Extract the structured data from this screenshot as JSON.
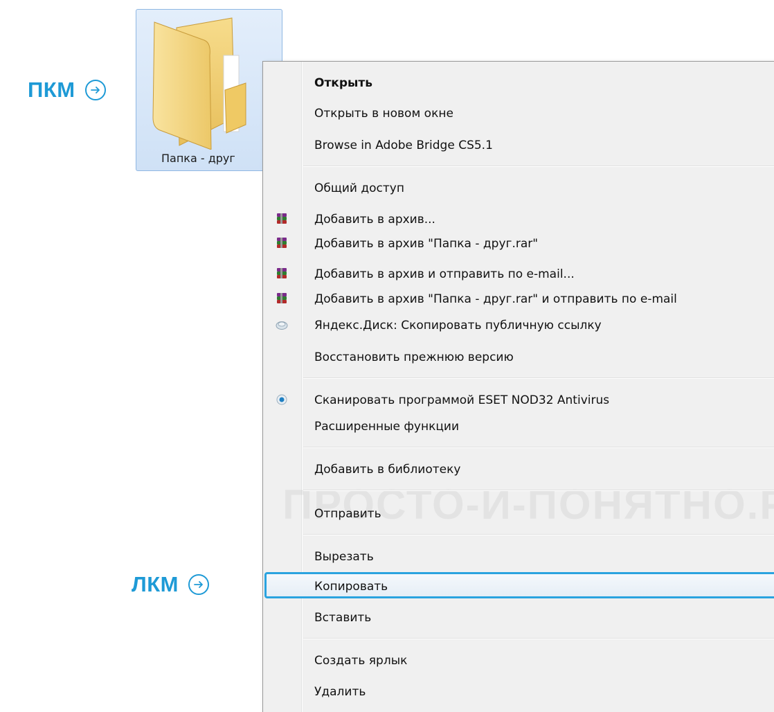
{
  "colors": {
    "annotation": "#1e9ad6",
    "highlight_border": "#2aa3df",
    "menu_bg": "#f0f0f0",
    "folder_yellow": "#f3d27a"
  },
  "annotations": {
    "right_click": "ПКМ",
    "left_click": "ЛКМ"
  },
  "folder": {
    "label": "Папка - друг",
    "icon": "folder-icon"
  },
  "menu": {
    "items": [
      {
        "label": "Открыть",
        "icon": null
      },
      {
        "label": "Открыть в новом окне",
        "icon": null
      },
      {
        "label": "Browse in Adobe Bridge CS5.1",
        "icon": null
      },
      {
        "label": "Общий доступ",
        "icon": null
      },
      {
        "label": "Добавить в архив...",
        "icon": "winrar-icon"
      },
      {
        "label": "Добавить в архив \"Папка - друг.rar\"",
        "icon": "winrar-icon"
      },
      {
        "label": "Добавить в архив и отправить по e-mail...",
        "icon": "winrar-icon"
      },
      {
        "label": "Добавить в архив \"Папка - друг.rar\" и отправить по e-mail",
        "icon": "winrar-icon"
      },
      {
        "label": "Яндекс.Диск: Скопировать публичную ссылку",
        "icon": "yandex-disk-icon"
      },
      {
        "label": "Восстановить прежнюю версию",
        "icon": null
      },
      {
        "label": "Сканировать программой ESET NOD32 Antivirus",
        "icon": "eset-icon"
      },
      {
        "label": "Расширенные функции",
        "icon": null
      },
      {
        "label": "Добавить в библиотеку",
        "icon": null
      },
      {
        "label": "Отправить",
        "icon": null
      },
      {
        "label": "Вырезать",
        "icon": null
      },
      {
        "label": "Копировать",
        "icon": null,
        "highlighted": true
      },
      {
        "label": "Вставить",
        "icon": null
      },
      {
        "label": "Создать ярлык",
        "icon": null
      },
      {
        "label": "Удалить",
        "icon": null
      }
    ]
  },
  "watermark": "ПРОСТО-И-ПОНЯТНО.РФ"
}
